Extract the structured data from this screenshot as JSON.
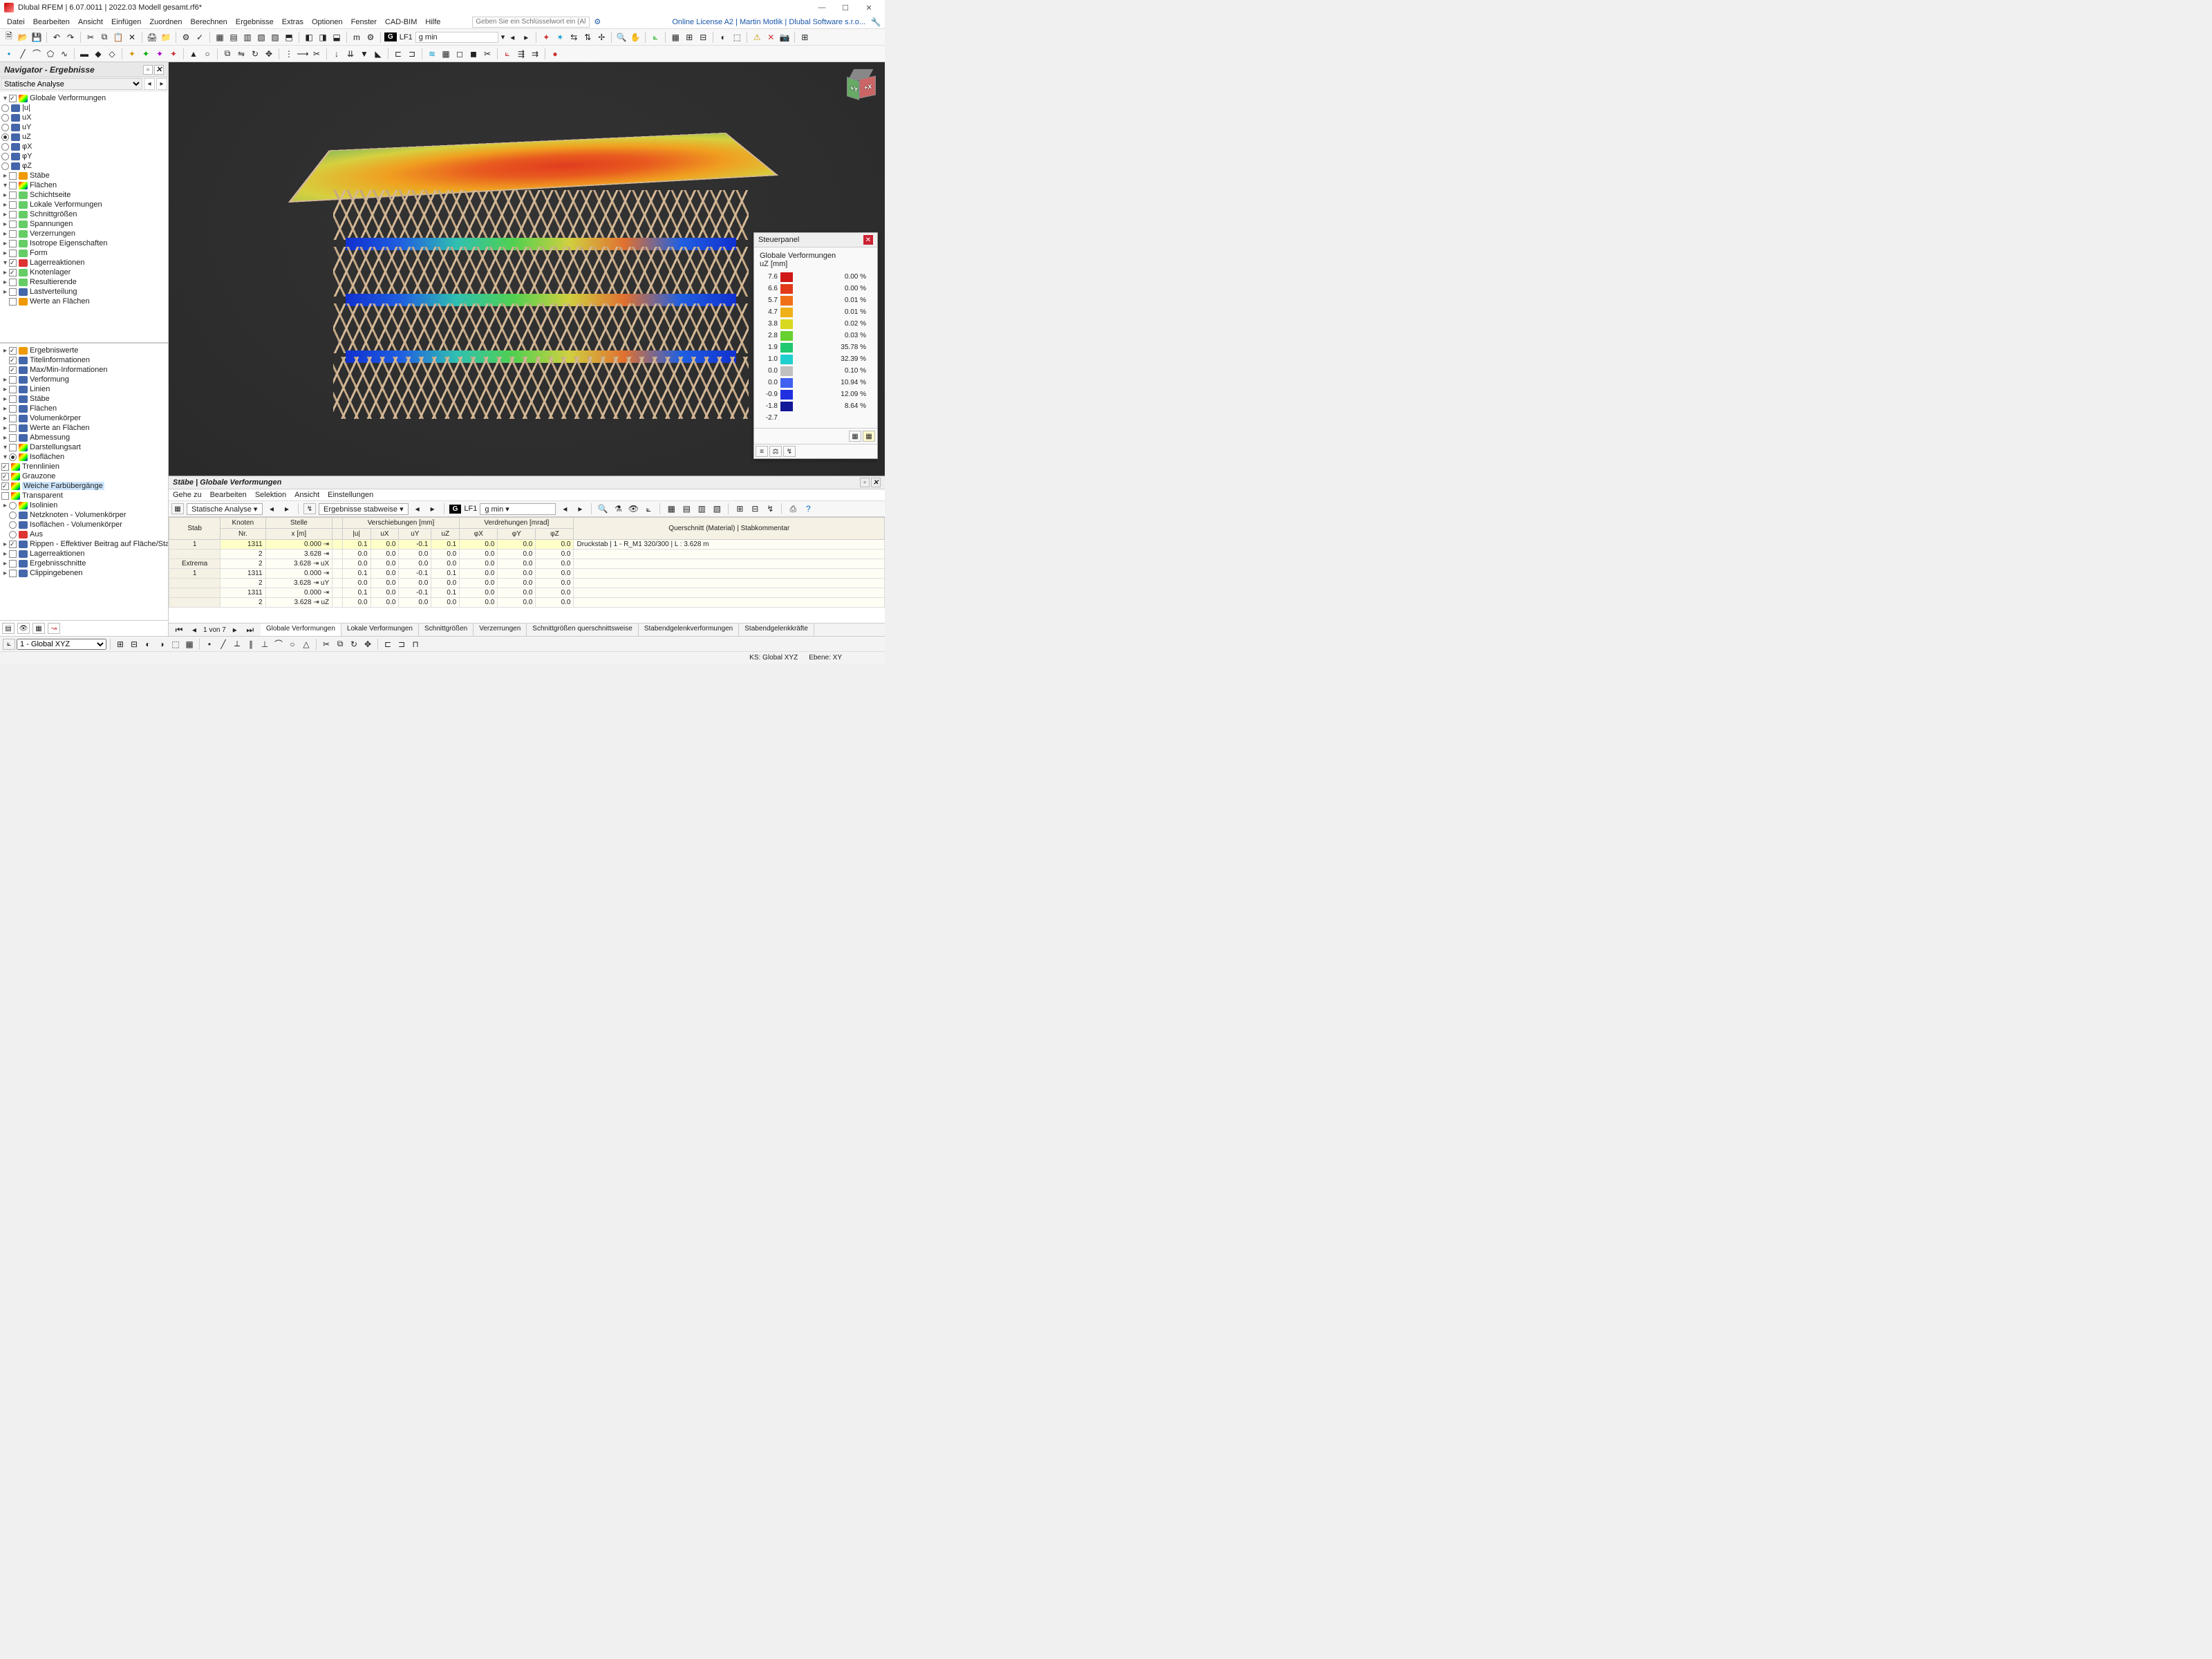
{
  "title": "Dlubal RFEM | 6.07.0011 | 2022.03 Modell gesamt.rf6*",
  "license_text": "Online License A2 | Martin Motlik | Dlubal Software s.r.o...",
  "menu": [
    "Datei",
    "Bearbeiten",
    "Ansicht",
    "Einfügen",
    "Zuordnen",
    "Berechnen",
    "Ergebnisse",
    "Extras",
    "Optionen",
    "Fenster",
    "CAD-BIM",
    "Hilfe"
  ],
  "search_placeholder": "Geben Sie ein Schlüsselwort ein (Alt+Q)",
  "loadcase": {
    "badge": "G",
    "id": "LF1",
    "name": "g min"
  },
  "navigator": {
    "title": "Navigator - Ergebnisse",
    "combo": "Statische Analyse",
    "tree_top": {
      "globale": "Globale Verformungen",
      "u": "|u|",
      "ux": "uX",
      "uy": "uY",
      "uz": "uZ",
      "phix": "φX",
      "phiy": "φY",
      "phiz": "φZ",
      "stabe": "Stäbe",
      "flachen": "Flächen",
      "fl_items": [
        "Schichtseite",
        "Lokale Verformungen",
        "Schnittgrößen",
        "Spannungen",
        "Verzerrungen",
        "Isotrope Eigenschaften",
        "Form"
      ],
      "lager": "Lagerreaktionen",
      "lager_items": [
        "Knotenlager",
        "Resultierende"
      ],
      "lastv": "Lastverteilung",
      "werte_fl": "Werte an Flächen"
    },
    "tree_bot": {
      "ergw": "Ergebniswerte",
      "titel": "Titelinformationen",
      "maxmin": "Max/Min-Informationen",
      "verf": "Verformung",
      "linien": "Linien",
      "stabe": "Stäbe",
      "flachen": "Flächen",
      "vol": "Volumenkörper",
      "werte": "Werte an Flächen",
      "abm": "Abmessung",
      "darst": "Darstellungsart",
      "isof": "Isoflächen",
      "trenn": "Trennlinien",
      "grau": "Grauzone",
      "weiche": "Weiche Farbübergänge",
      "transp": "Transparent",
      "isol": "Isolinien",
      "netz": "Netzknoten - Volumenkörper",
      "isofv": "Isoflächen - Volumenkörper",
      "aus": "Aus",
      "rippen": "Rippen - Effektiver Beitrag auf Fläche/Stab",
      "lagerr": "Lagerreaktionen",
      "ergs": "Ergebnisschnitte",
      "clip": "Clippingebenen"
    }
  },
  "steuer": {
    "title": "Steuerpanel",
    "subtitle": "Globale Verformungen",
    "unit": "uZ [mm]",
    "rows": [
      {
        "v": "7.6",
        "c": "#d01818",
        "p": "0.00 %"
      },
      {
        "v": "6.6",
        "c": "#e23a18",
        "p": "0.00 %"
      },
      {
        "v": "5.7",
        "c": "#f07018",
        "p": "0.01 %"
      },
      {
        "v": "4.7",
        "c": "#f0b018",
        "p": "0.01 %"
      },
      {
        "v": "3.8",
        "c": "#d8d820",
        "p": "0.02 %"
      },
      {
        "v": "2.8",
        "c": "#68d030",
        "p": "0.03 %"
      },
      {
        "v": "1.9",
        "c": "#20c870",
        "p": "35.78 %"
      },
      {
        "v": "1.0",
        "c": "#20d0d0",
        "p": "32.39 %"
      },
      {
        "v": "0.0",
        "c": "#c0c0c0",
        "p": "0.10 %"
      },
      {
        "v": "0.0",
        "c": "#4060f0",
        "p": "10.94 %"
      },
      {
        "v": "-0.9",
        "c": "#2030e0",
        "p": "12.09 %"
      },
      {
        "v": "-1.8",
        "c": "#101898",
        "p": "8.64 %"
      },
      {
        "v": "-2.7",
        "c": "",
        "p": ""
      }
    ]
  },
  "results": {
    "title": "Stäbe | Globale Verformungen",
    "menu": [
      "Gehe zu",
      "Bearbeiten",
      "Selektion",
      "Ansicht",
      "Einstellungen"
    ],
    "combo1": "Statische Analyse",
    "combo2": "Ergebnisse stabweise",
    "headers": {
      "stab": "Stab",
      "nr_stab": "Nr.",
      "knoten": "Knoten",
      "nr_knoten": "Nr.",
      "stelle": "Stelle",
      "xm": "x [m]",
      "versch": "Verschiebungen [mm]",
      "u": "|u|",
      "ux": "uX",
      "uy": "uY",
      "uz": "uZ",
      "verdr": "Verdrehungen [mrad]",
      "phix": "φX",
      "phiy": "φY",
      "phiz": "φZ",
      "quer": "Querschnitt (Material) | Stabkommentar"
    },
    "rows": [
      {
        "s": "1",
        "k": "1311",
        "x": "0.000",
        "u": "0.1",
        "ux": "0.0",
        "uy": "-0.1",
        "uz": "0.1",
        "px": "0.0",
        "py": "0.0",
        "pz": "0.0",
        "q": "Druckstab | 1 - R_M1 320/300 | L : 3.628 m"
      },
      {
        "s": "",
        "k": "2",
        "x": "3.628",
        "u": "0.0",
        "ux": "0.0",
        "uy": "0.0",
        "uz": "0.0",
        "px": "0.0",
        "py": "0.0",
        "pz": "0.0",
        "q": ""
      },
      {
        "s": "Extrema",
        "k": "2",
        "x": "3.628",
        "sf": "uX",
        "u": "0.0",
        "ux": "0.0",
        "uy": "0.0",
        "uz": "0.0",
        "px": "0.0",
        "py": "0.0",
        "pz": "0.0",
        "q": ""
      },
      {
        "s": "1",
        "k": "1311",
        "x": "0.000",
        "u": "0.1",
        "ux": "0.0",
        "uy": "-0.1",
        "uz": "0.1",
        "px": "0.0",
        "py": "0.0",
        "pz": "0.0",
        "q": ""
      },
      {
        "s": "",
        "k": "2",
        "x": "3.628",
        "sf": "uY",
        "u": "0.0",
        "ux": "0.0",
        "uy": "0.0",
        "uz": "0.0",
        "px": "0.0",
        "py": "0.0",
        "pz": "0.0",
        "q": ""
      },
      {
        "s": "",
        "k": "1311",
        "x": "0.000",
        "u": "0.1",
        "ux": "0.0",
        "uy": "-0.1",
        "uz": "0.1",
        "px": "0.0",
        "py": "0.0",
        "pz": "0.0",
        "q": ""
      },
      {
        "s": "",
        "k": "2",
        "x": "3.628",
        "sf": "uZ",
        "u": "0.0",
        "ux": "0.0",
        "uy": "0.0",
        "uz": "0.0",
        "px": "0.0",
        "py": "0.0",
        "pz": "0.0",
        "q": ""
      }
    ],
    "pager": "1 von 7",
    "tabs": [
      "Globale Verformungen",
      "Lokale Verformungen",
      "Schnittgrößen",
      "Verzerrungen",
      "Schnittgrößen querschnittsweise",
      "Stabendgelenkverformungen",
      "Stabendgelenkkräfte"
    ]
  },
  "status": {
    "cs": "1 - Global XYZ",
    "ks": "KS: Global XYZ",
    "ebene": "Ebene: XY"
  }
}
